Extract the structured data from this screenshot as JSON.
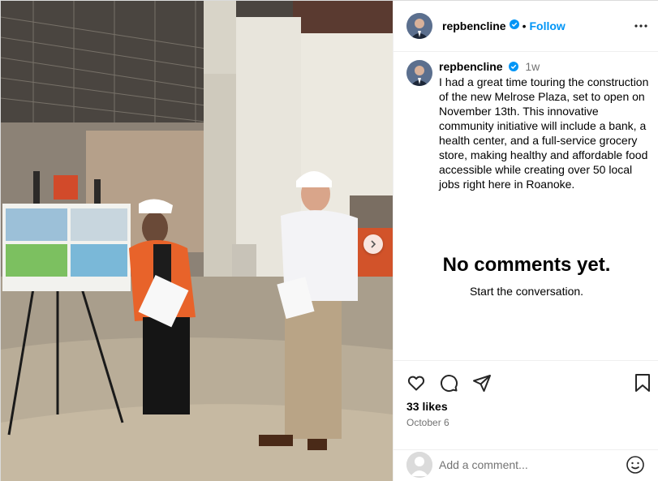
{
  "post": {
    "username": "repbencline",
    "follow_label": "Follow",
    "separator": "•",
    "caption_time": "1w",
    "caption_text": "I had a great time touring the construction of the new Melrose Plaza, set to open on November 13th. This innovative community initiative will include a bank, a health center, and a full-service grocery store, making healthy and affordable food accessible while creating over 50 local jobs right here in Roanoke."
  },
  "comments": {
    "empty_title": "No comments yet.",
    "empty_subtitle": "Start the conversation."
  },
  "engagement": {
    "likes": "33 likes",
    "date": "October 6"
  },
  "comment_box": {
    "placeholder": "Add a comment..."
  },
  "icons": {
    "verified": "verified-badge-icon",
    "more": "more-options-icon",
    "like": "heart-icon",
    "comment": "comment-bubble-icon",
    "share": "paper-plane-icon",
    "save": "bookmark-icon",
    "emoji": "emoji-icon",
    "next": "chevron-right-icon"
  },
  "colors": {
    "accent": "#0095f6",
    "secondary_text": "#737373",
    "border": "#efefef"
  }
}
